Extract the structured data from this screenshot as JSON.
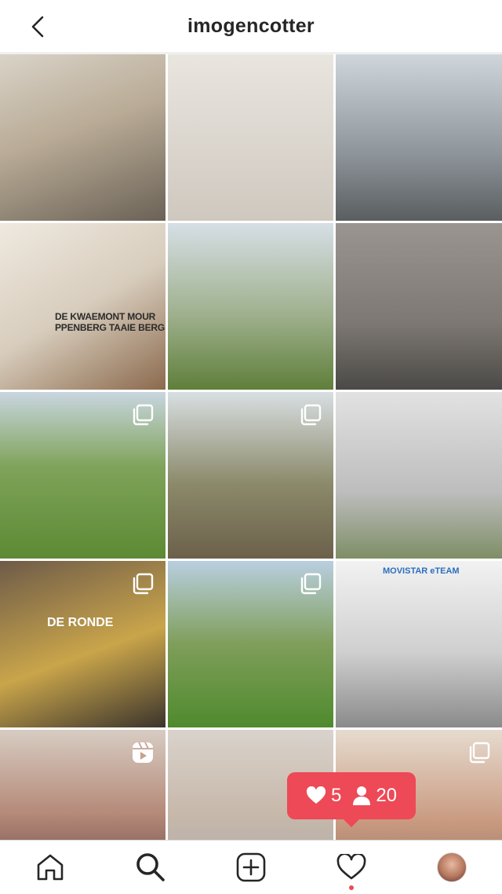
{
  "header": {
    "title": "imogencotter"
  },
  "grid": {
    "tiles": [
      {
        "overlay": "none",
        "caption": ""
      },
      {
        "overlay": "none",
        "caption": ""
      },
      {
        "overlay": "none",
        "caption": ""
      },
      {
        "overlay": "none",
        "caption": "DE KWAEMONT MOUR PPENBERG TAAIE BERG"
      },
      {
        "overlay": "none",
        "caption": ""
      },
      {
        "overlay": "none",
        "caption": ""
      },
      {
        "overlay": "carousel",
        "caption": ""
      },
      {
        "overlay": "carousel",
        "caption": ""
      },
      {
        "overlay": "none",
        "caption": ""
      },
      {
        "overlay": "carousel",
        "caption": "DE RONDE"
      },
      {
        "overlay": "carousel",
        "caption": ""
      },
      {
        "overlay": "none",
        "caption": "MOVISTAR eTEAM"
      },
      {
        "overlay": "reel",
        "caption": ""
      },
      {
        "overlay": "none",
        "caption": ""
      },
      {
        "overlay": "carousel",
        "caption": ""
      }
    ]
  },
  "notification": {
    "likes": "5",
    "followers": "20",
    "color": "#ed4956"
  },
  "bottom_nav": {
    "items": [
      "home-icon",
      "search-icon",
      "new-post-icon",
      "activity-icon",
      "profile-avatar"
    ]
  }
}
